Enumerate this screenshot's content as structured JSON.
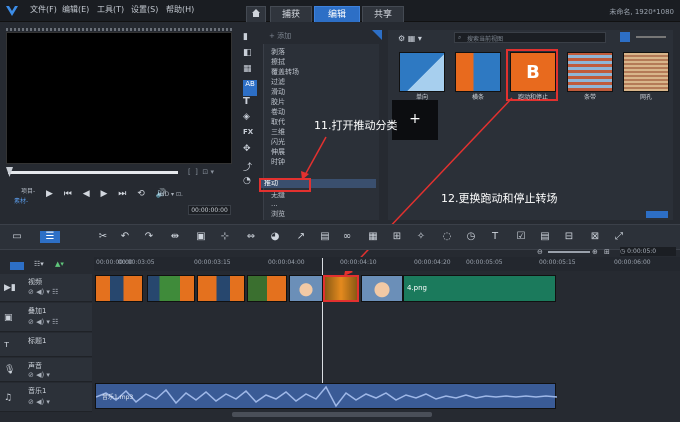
{
  "menus": [
    "文件(F)",
    "编辑(E)",
    "工具(T)",
    "设置(S)",
    "帮助(H)"
  ],
  "tabs": {
    "capture": "捕获",
    "edit": "编辑",
    "share": "共享"
  },
  "resolution": "未命名, 1920*1080",
  "preview": {
    "project_label": "项目-",
    "clip_label": "素材-",
    "timecode": "00:00:00:00"
  },
  "library": {
    "add_label": "添加",
    "search_placeholder": "搜索当前视图",
    "thumbs": [
      {
        "label": "单向",
        "color": "#2e79c2"
      },
      {
        "label": "横条",
        "color": "#2e79c2"
      },
      {
        "label": "跑动和停止",
        "color": "#e86a1e"
      },
      {
        "label": "条带",
        "color": "#c05a3a"
      },
      {
        "label": "网孔",
        "color": "#d8b58a"
      }
    ],
    "fav_plus": "+"
  },
  "categories": [
    "剥落",
    "擦拭",
    "覆盖转场",
    "过滤",
    "滑动",
    "胶片",
    "卷动",
    "取代",
    "三维",
    "闪光",
    "伸展",
    "时钟",
    "推动",
    "无缝",
    "...",
    "浏览"
  ],
  "selected_category": "推动",
  "annotations": {
    "a1": "11.打开推动分类",
    "a2": "12.更换跑动和停止转场"
  },
  "ruler": {
    "start": "00:00:00:00",
    "ticks": [
      "00:00:03:05",
      "00:00:03:15",
      "00:00:04:00",
      "00:00:04:10",
      "00:00:04:20",
      "00:00:05:05",
      "00:00:05:15",
      "00:00:06:00"
    ],
    "current": "0:00:05:0"
  },
  "tracks": {
    "video": "视频",
    "overlay": "叠加1",
    "title": "标题1",
    "voice": "声音",
    "music": "音乐1"
  },
  "clips": {
    "png_label": "4.png",
    "music_label": "音乐1.mp3"
  },
  "colors": {
    "accent": "#2d6fc6",
    "annot": "#e2312f",
    "png": "#1b7a5c",
    "audio": "#3a5b96"
  }
}
